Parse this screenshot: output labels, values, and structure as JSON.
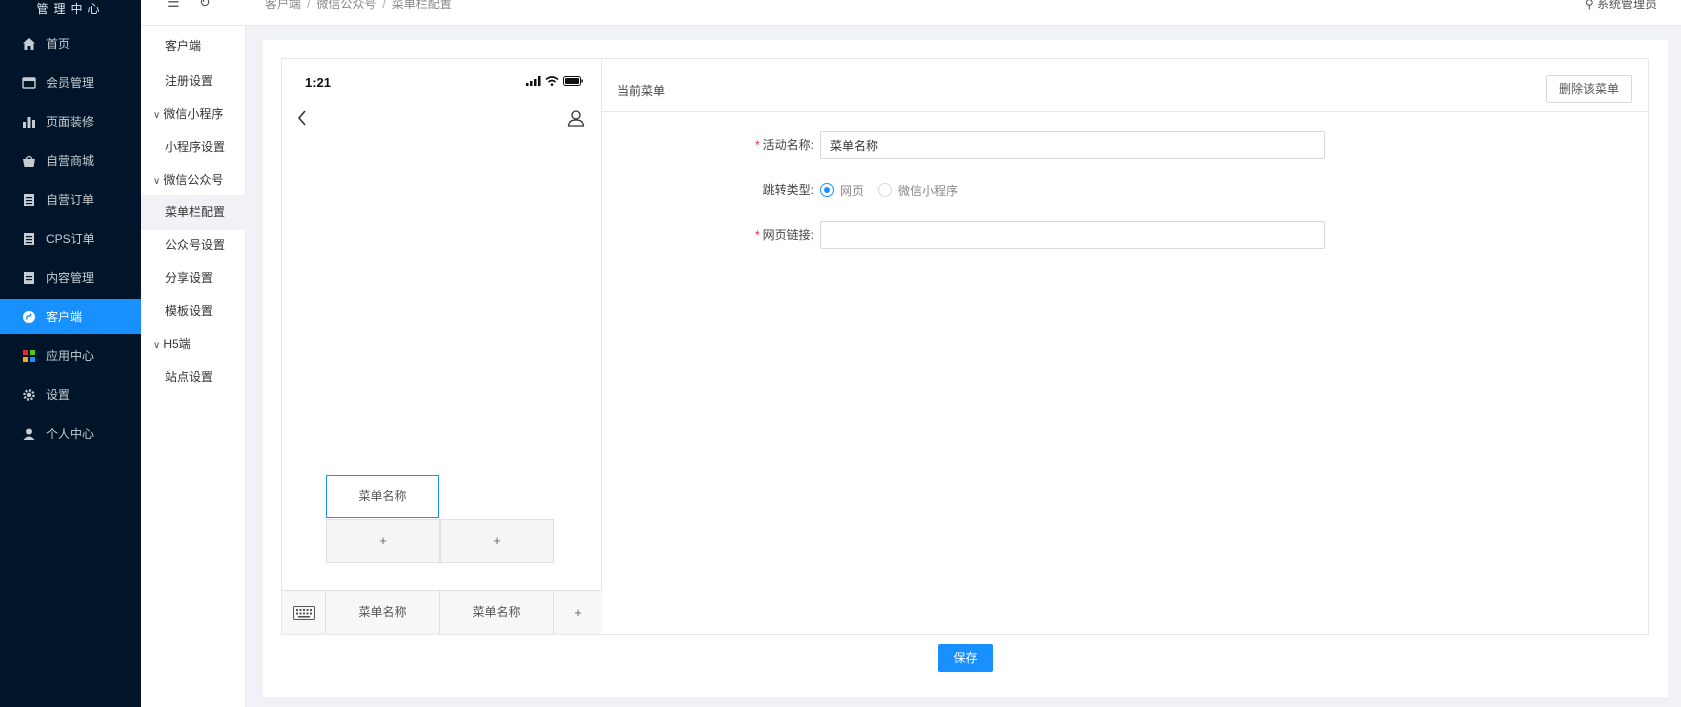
{
  "sidebar": {
    "brand": "管理中心",
    "items": [
      {
        "label": "首页",
        "icon": "home-icon"
      },
      {
        "label": "会员管理",
        "icon": "member-icon"
      },
      {
        "label": "页面装修",
        "icon": "bar-chart-icon"
      },
      {
        "label": "自营商城",
        "icon": "basket-icon"
      },
      {
        "label": "自营订单",
        "icon": "order-icon"
      },
      {
        "label": "CPS订单",
        "icon": "order-icon"
      },
      {
        "label": "内容管理",
        "icon": "document-icon"
      },
      {
        "label": "客户端",
        "icon": "client-icon",
        "active": true
      },
      {
        "label": "应用中心",
        "icon": "apps-icon"
      },
      {
        "label": "设置",
        "icon": "gear-icon"
      },
      {
        "label": "个人中心",
        "icon": "person-icon"
      }
    ]
  },
  "topbar": {
    "breadcrumb": [
      "客户端",
      "微信公众号",
      "菜单栏配置"
    ],
    "user": "系统管理员"
  },
  "submenu": {
    "items": [
      {
        "label": "客户端",
        "group": false
      },
      {
        "label": "注册设置",
        "group": false
      },
      {
        "label": "微信小程序",
        "group": true
      },
      {
        "label": "小程序设置",
        "group": false
      },
      {
        "label": "微信公众号",
        "group": true
      },
      {
        "label": "菜单栏配置",
        "group": false,
        "active": true
      },
      {
        "label": "公众号设置",
        "group": false
      },
      {
        "label": "分享设置",
        "group": false
      },
      {
        "label": "模板设置",
        "group": false
      },
      {
        "label": "H5端",
        "group": true
      },
      {
        "label": "站点设置",
        "group": false
      }
    ]
  },
  "phone": {
    "time": "1:21",
    "submenu_selected": "菜单名称",
    "submenu_add_1": "+",
    "submenu_add_2": "+",
    "menu_items": [
      "菜单名称",
      "菜单名称"
    ],
    "menu_add": "+"
  },
  "panel": {
    "title": "当前菜单",
    "delete_label": "删除该菜单",
    "name_label": "活动名称:",
    "name_value": "菜单名称",
    "type_label": "跳转类型:",
    "type_options": [
      "网页",
      "微信小程序"
    ],
    "type_selected": "网页",
    "link_label": "网页链接:",
    "link_value": ""
  },
  "save_label": "保存",
  "colors": {
    "sidebar_bg": "#001529",
    "accent": "#1890ff",
    "required": "#f5222d"
  }
}
